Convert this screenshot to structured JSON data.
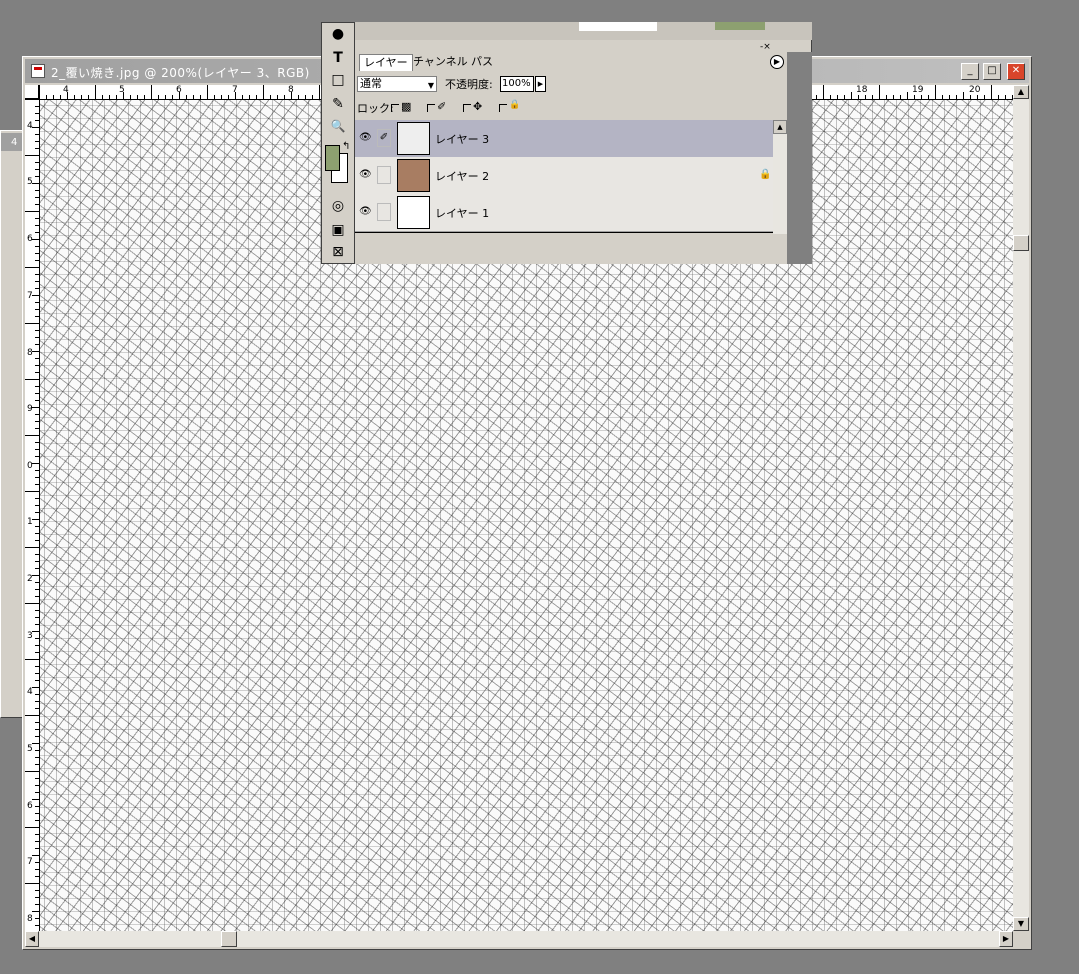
{
  "document": {
    "title": "2_覆い焼き.jpg @ 200%(レイヤー 3、RGB)",
    "window_buttons": {
      "minimize": "_",
      "maximize": "□",
      "close": "✕"
    },
    "ruler_top_labels": [
      "4",
      "5",
      "6",
      "7",
      "8",
      "18",
      "19",
      "20"
    ],
    "ruler_left_labels": [
      "4",
      "5",
      "6",
      "7",
      "8",
      "9",
      "0",
      "1",
      "2",
      "3",
      "4",
      "5",
      "6",
      "7",
      "8"
    ]
  },
  "back_window": {
    "number": "4"
  },
  "toolbox": {
    "tools": [
      {
        "icon": "dodge-icon",
        "glyph": "●"
      },
      {
        "icon": "type-icon",
        "glyph": "T"
      },
      {
        "icon": "rectangle-icon",
        "glyph": "□"
      },
      {
        "icon": "eyedropper-icon",
        "glyph": "✎"
      },
      {
        "icon": "zoom-icon",
        "glyph": "🔍"
      }
    ],
    "swap_glyph": "↰",
    "mask_glyph": "◎",
    "screen_glyph": "▣",
    "jump_glyph": "⊠",
    "colors": {
      "foreground": "#8da070",
      "background": "#ffffff"
    }
  },
  "layers_panel": {
    "close_glyph": "-×",
    "tabs": [
      "レイヤー",
      "チャンネル",
      "パス"
    ],
    "menu_glyph": "▶",
    "blend_mode": "通常",
    "opacity_label": "不透明度:",
    "opacity_value": "100%",
    "lock_label": "ロック:",
    "layers": [
      {
        "name": "レイヤー 3",
        "selected": true,
        "link_glyph": "✐",
        "thumb_color": "#eeeeee",
        "locked": false
      },
      {
        "name": "レイヤー 2",
        "selected": false,
        "link_glyph": "",
        "thumb_color": "#a87d62",
        "locked": true
      },
      {
        "name": "レイヤー 1",
        "selected": false,
        "link_glyph": "",
        "thumb_color": "#ffffff",
        "locked": false
      }
    ],
    "eye_glyph": "👁",
    "lock_glyph": "🔒"
  }
}
